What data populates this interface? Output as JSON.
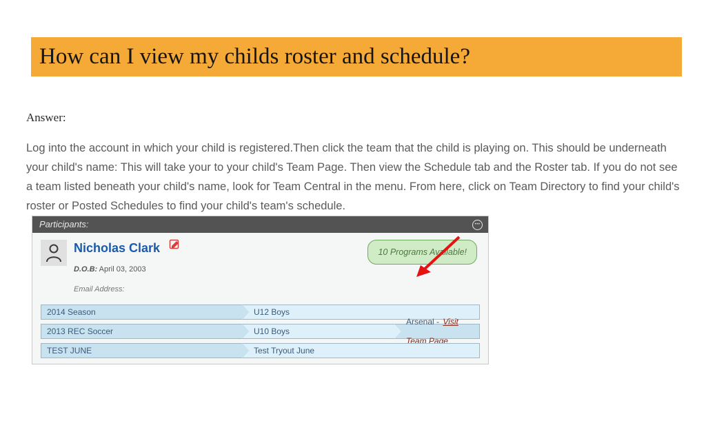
{
  "title": "How can I view my childs roster and schedule?",
  "answer_label": "Answer:",
  "answer_text": "Log into the account in which your child is registered.Then click the team that the child is playing on. This should be underneath your child's name: This will take your to your child's Team Page.  Then view the Schedule tab and the Roster tab. If you do not see a team listed beneath your child's name, look for Team Central in the menu. From here, click on Team Directory to find your child's roster or Posted Schedules to find your child's team's schedule.",
  "panel": {
    "header": "Participants:",
    "participant": {
      "name": "Nicholas Clark",
      "dob_label": "D.O.B:",
      "dob_value": " April 03, 2003",
      "email_label": "Email Address:",
      "programs_badge": "10 Programs Available!"
    },
    "rows": [
      {
        "a": "2014 Season",
        "b": "U12 Boys",
        "c": ""
      },
      {
        "a": "2013 REC Soccer",
        "b": "U10 Boys",
        "c_prefix": "Arsenal - ",
        "c_link": "Visit Team Page"
      },
      {
        "a": "TEST JUNE",
        "b": "Test Tryout June",
        "c": ""
      }
    ]
  }
}
